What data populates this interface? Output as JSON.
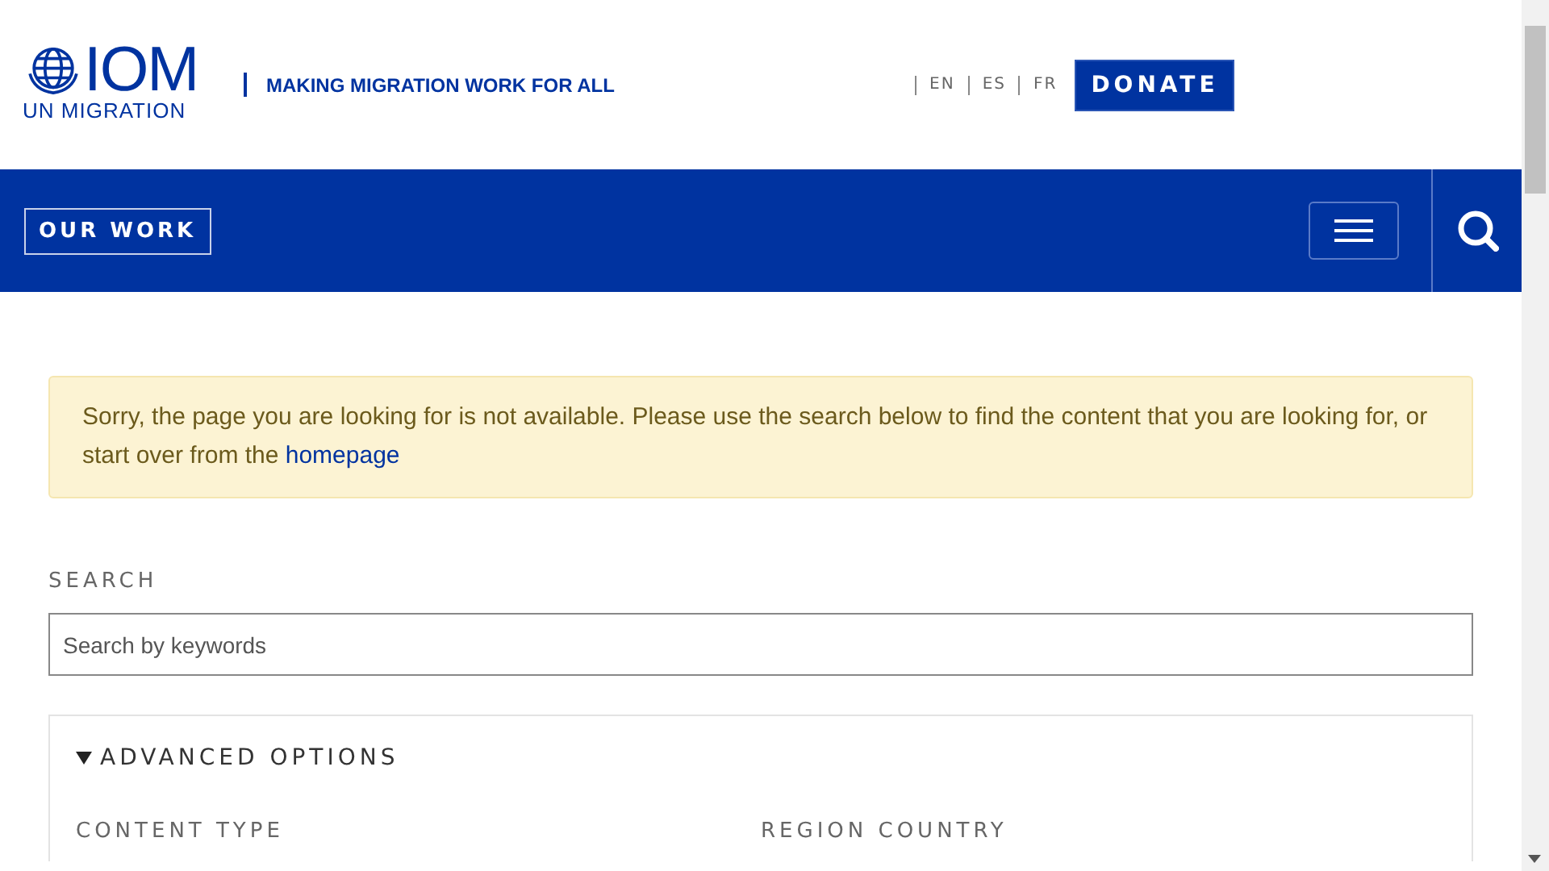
{
  "header": {
    "logo": {
      "name": "IOM",
      "subtitle": "UN MIGRATION"
    },
    "tagline": "MAKING MIGRATION WORK FOR ALL",
    "languages": [
      {
        "label": "EN",
        "selected": false
      },
      {
        "label": "ES",
        "selected": false
      },
      {
        "label": "FR",
        "selected": false
      }
    ],
    "donate": "DONATE"
  },
  "nav": {
    "menu_label": "OUR WORK"
  },
  "alert": {
    "text": "Sorry, the page you are looking for is not available. Please use the search below to find the content that you are looking for, or start over from the ",
    "link": "homepage"
  },
  "search": {
    "label": "SEARCH",
    "placeholder": "Search by keywords"
  },
  "advanced": {
    "title": "ADVANCED OPTIONS",
    "expanded": true,
    "fields": [
      "CONTENT TYPE",
      "REGION COUNTRY"
    ]
  }
}
